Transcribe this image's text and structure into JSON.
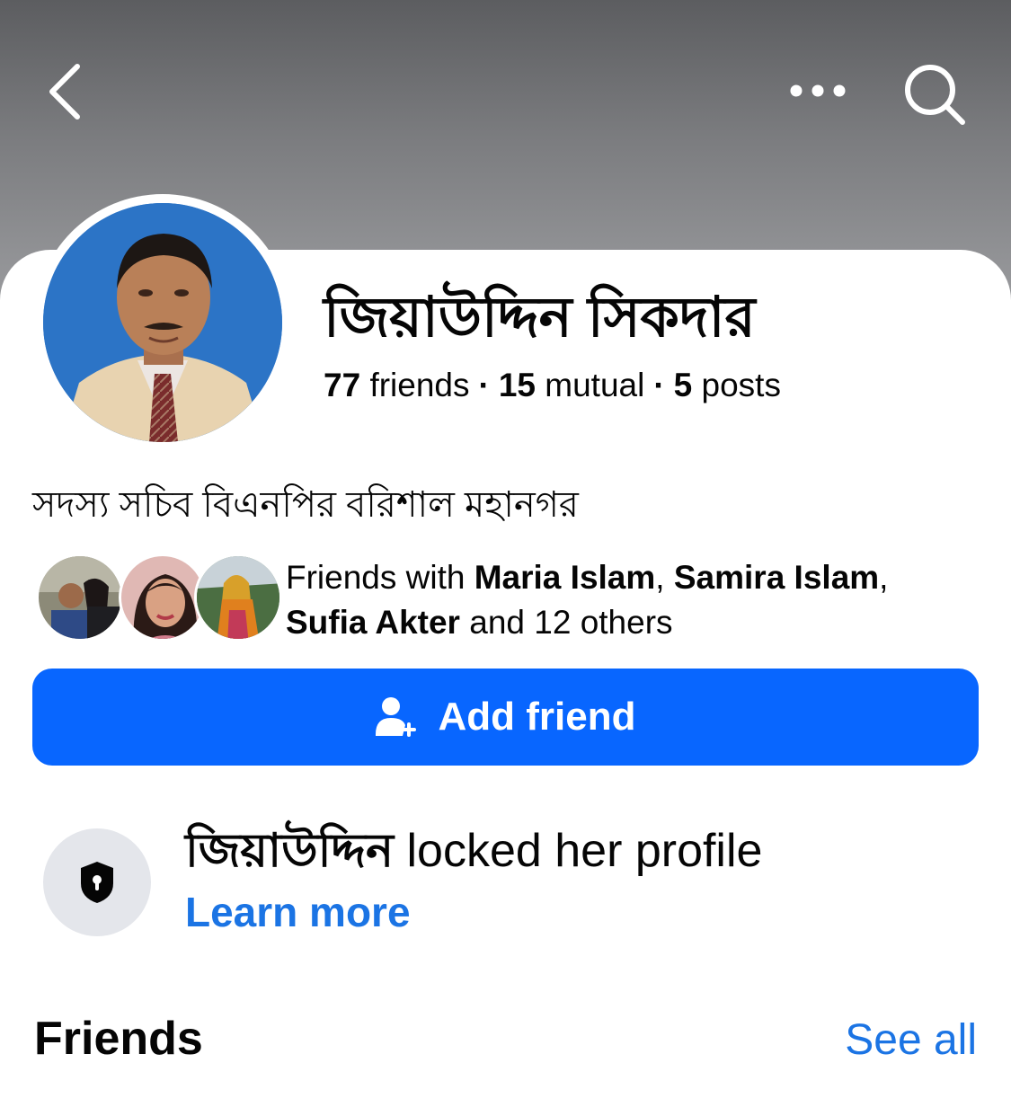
{
  "profile": {
    "name": "জিয়াউদ্দিন সিকদার",
    "friends_count": "77",
    "friends_label": "friends",
    "mutual_count": "15",
    "mutual_label": "mutual",
    "posts_count": "5",
    "posts_label": "posts",
    "separator": "·",
    "bio": "সদস্য সচিব বিএনপির বরিশাল মহানগর"
  },
  "mutual": {
    "prefix": "Friends with",
    "friend1": "Maria Islam",
    "comma1": ",",
    "friend2": "Samira Islam",
    "comma2": ",",
    "friend3": "Sufia Akter",
    "suffix": "and 12 others"
  },
  "actions": {
    "add_friend_label": "Add friend"
  },
  "locked": {
    "first_name": "জিয়াউদ্দিন",
    "message": "locked her profile",
    "learn_more": "Learn more"
  },
  "friends_section": {
    "heading": "Friends",
    "see_all": "See all"
  },
  "icons": {
    "back": "chevron-left-icon",
    "more": "more-dots-icon",
    "search": "search-icon",
    "add_friend": "add-person-icon",
    "lock": "shield-lock-icon"
  },
  "colors": {
    "primary_button": "#0866ff",
    "link": "#1b74e4",
    "header_gradient_top": "#5c5d60",
    "lock_bg": "#e4e6eb"
  }
}
